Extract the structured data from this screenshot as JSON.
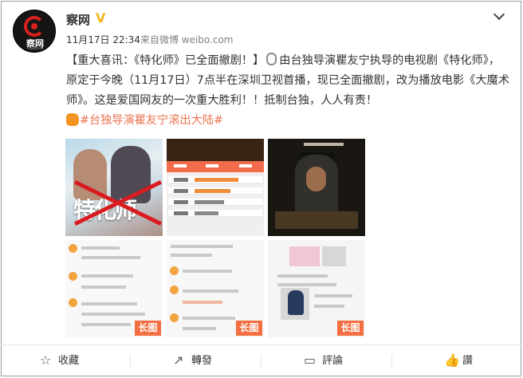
{
  "post": {
    "author": "察网",
    "verified_icon": "verified-v-icon",
    "logo_text": "察网",
    "logo_url": "CWZG.CN",
    "time": "11月17日 22:34",
    "source": "来自微博 weibo.com",
    "text_parts": {
      "headline": "【重大喜讯：《特化师》已全面撤剧！】",
      "body": "由台独导演瞿友宁执导的电视剧《特化师》，原定于今晚（11月17日）7点半在深圳卫视首播，现已全面撤剧，改为播放电影《大魔术师》。这是爱国网友的一次重大胜利！！抵制台独，人人有责！",
      "hashtag": "#台独导演瞿友宁滚出大陆#"
    },
    "images": [
      {
        "type": "poster",
        "title_text": "特化师",
        "long_label": ""
      },
      {
        "type": "schedule-screenshot",
        "long_label": ""
      },
      {
        "type": "movie-still",
        "long_label": ""
      },
      {
        "type": "comment-screenshot",
        "long_label": "长图"
      },
      {
        "type": "comment-screenshot",
        "long_label": "长图"
      },
      {
        "type": "comment-screenshot",
        "long_label": "长图"
      }
    ]
  },
  "actions": [
    {
      "icon": "star-outline-icon",
      "label": "收藏"
    },
    {
      "icon": "repost-icon",
      "label": "轉發"
    },
    {
      "icon": "comment-icon",
      "label": "評論"
    },
    {
      "icon": "thumbs-up-icon",
      "label": "讚"
    }
  ],
  "colors": {
    "accent": "#eb7350",
    "badge": "#f36e40",
    "verified": "#f5b315"
  }
}
